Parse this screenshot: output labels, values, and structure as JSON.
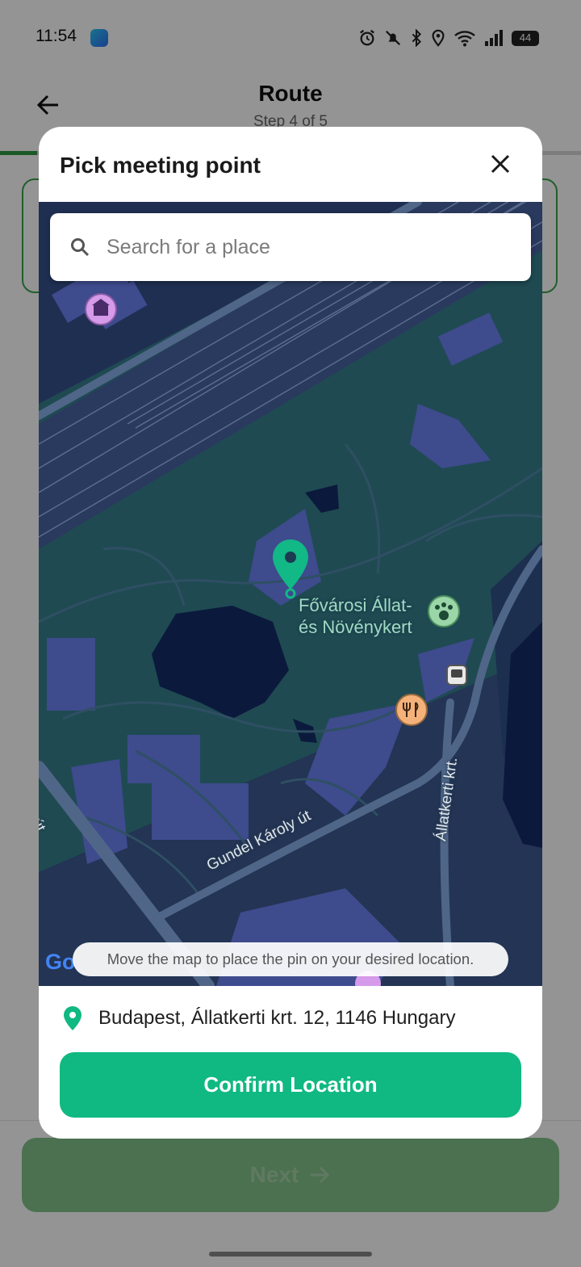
{
  "status_bar": {
    "time": "11:54",
    "battery_level": "44",
    "icons": [
      "alarm-icon",
      "mute-icon",
      "bluetooth-icon",
      "location-icon",
      "wifi-icon",
      "signal-icon",
      "battery-icon"
    ]
  },
  "header": {
    "title": "Route",
    "step_label": "Step 4 of 5",
    "progress_fraction": 0.8
  },
  "footer": {
    "next_label": "Next"
  },
  "modal": {
    "title": "Pick meeting point",
    "search": {
      "placeholder": "Search for a place",
      "value": ""
    },
    "map": {
      "place_label_line1": "Fővárosi Állat-",
      "place_label_line2": "és Növénykert",
      "streets": [
        "Gundel Károly út",
        "Állatkerti krt.",
        "ly út"
      ],
      "hint": "Move the map to place the pin on your desired location.",
      "attribution": "Go",
      "poi_icons": [
        "museum-icon",
        "zoo-icon",
        "bus-stop-icon",
        "restaurant-icon"
      ]
    },
    "address": "Budapest, Állatkerti krt. 12, 1146 Hungary",
    "confirm_label": "Confirm Location"
  },
  "colors": {
    "accent_green": "#10b981",
    "map_park": "#1e4f55",
    "map_water": "#0a1a3a",
    "next_button_disabled": "#84c38a"
  }
}
